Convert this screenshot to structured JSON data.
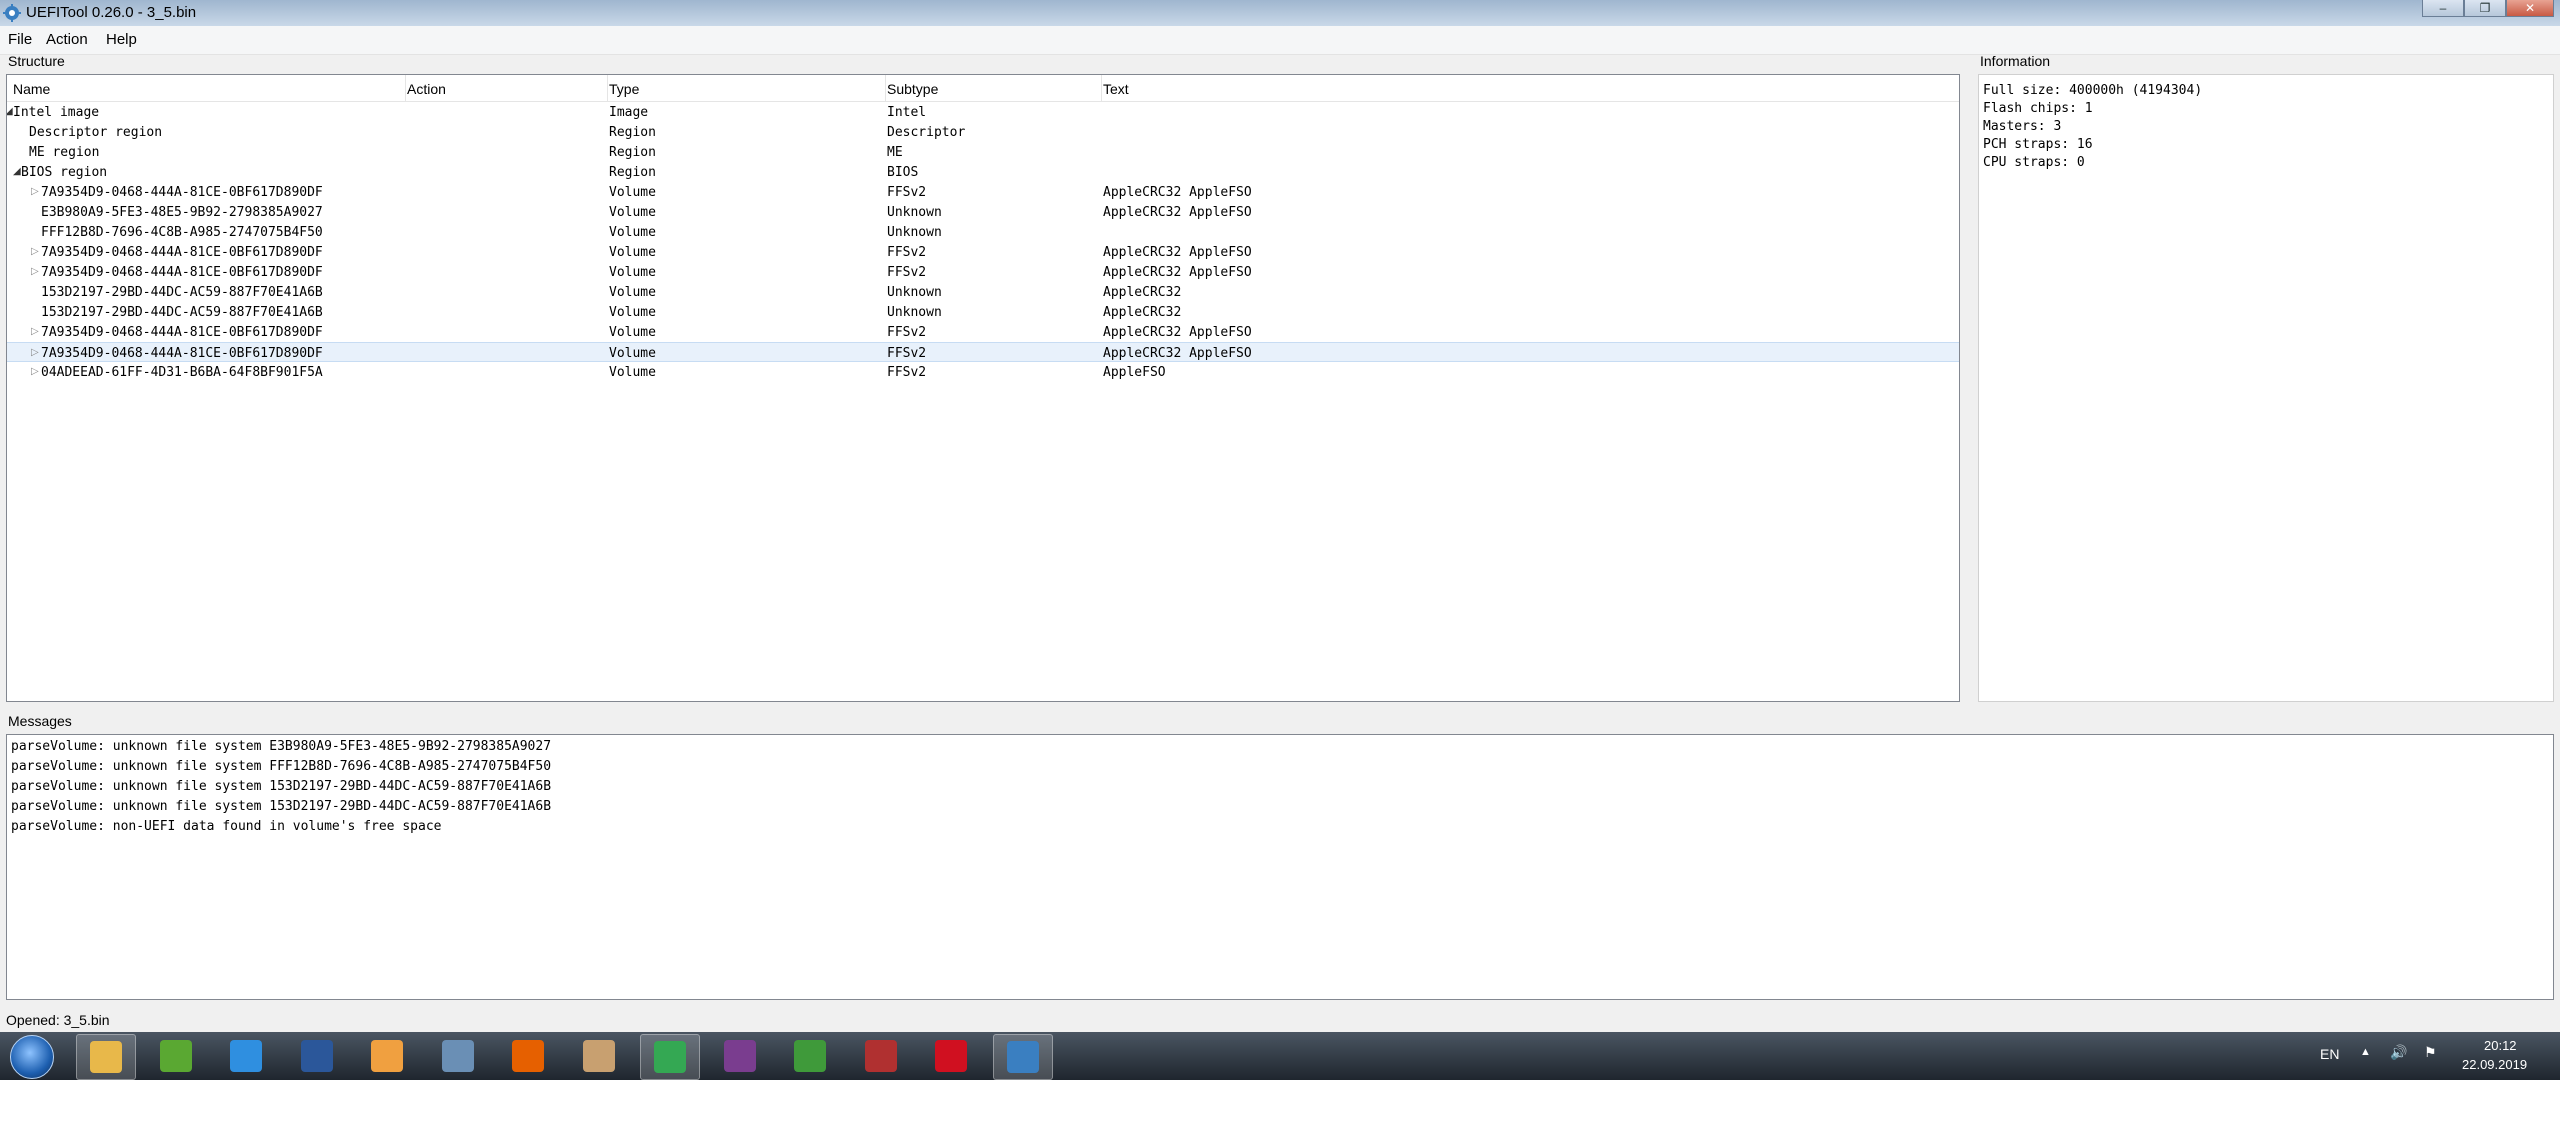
{
  "window": {
    "title": "UEFITool 0.26.0 - 3_5.bin",
    "controls": [
      "–",
      "❐",
      "✕"
    ]
  },
  "menu": [
    "File",
    "Action",
    "Help"
  ],
  "structure": {
    "label": "Structure",
    "columns": [
      "Name",
      "Action",
      "Type",
      "Subtype",
      "Text"
    ],
    "rows": [
      {
        "name": "Intel image",
        "type": "Image",
        "subtype": "Intel",
        "text": "",
        "arrow": "◢"
      },
      {
        "name": "Descriptor region",
        "type": "Region",
        "subtype": "Descriptor",
        "text": "",
        "arrow": ""
      },
      {
        "name": "ME region",
        "type": "Region",
        "subtype": "ME",
        "text": "",
        "arrow": ""
      },
      {
        "name": "BIOS region",
        "type": "Region",
        "subtype": "BIOS",
        "text": "",
        "arrow": "◢"
      },
      {
        "name": "7A9354D9-0468-444A-81CE-0BF617D890DF",
        "type": "Volume",
        "subtype": "FFSv2",
        "text": "AppleCRC32 AppleFSO",
        "arrow": "▷"
      },
      {
        "name": "E3B980A9-5FE3-48E5-9B92-2798385A9027",
        "type": "Volume",
        "subtype": "Unknown",
        "text": "AppleCRC32 AppleFSO",
        "arrow": ""
      },
      {
        "name": "FFF12B8D-7696-4C8B-A985-2747075B4F50",
        "type": "Volume",
        "subtype": "Unknown",
        "text": "",
        "arrow": ""
      },
      {
        "name": "7A9354D9-0468-444A-81CE-0BF617D890DF",
        "type": "Volume",
        "subtype": "FFSv2",
        "text": "AppleCRC32 AppleFSO",
        "arrow": "▷"
      },
      {
        "name": "7A9354D9-0468-444A-81CE-0BF617D890DF",
        "type": "Volume",
        "subtype": "FFSv2",
        "text": "AppleCRC32 AppleFSO",
        "arrow": "▷"
      },
      {
        "name": "153D2197-29BD-44DC-AC59-887F70E41A6B",
        "type": "Volume",
        "subtype": "Unknown",
        "text": "AppleCRC32",
        "arrow": ""
      },
      {
        "name": "153D2197-29BD-44DC-AC59-887F70E41A6B",
        "type": "Volume",
        "subtype": "Unknown",
        "text": "AppleCRC32",
        "arrow": ""
      },
      {
        "name": "7A9354D9-0468-444A-81CE-0BF617D890DF",
        "type": "Volume",
        "subtype": "FFSv2",
        "text": "AppleCRC32 AppleFSO",
        "arrow": "▷"
      },
      {
        "name": "7A9354D9-0468-444A-81CE-0BF617D890DF",
        "type": "Volume",
        "subtype": "FFSv2",
        "text": "AppleCRC32 AppleFSO",
        "arrow": "▷",
        "selected": true
      },
      {
        "name": "04ADEEAD-61FF-4D31-B6BA-64F8BF901F5A",
        "type": "Volume",
        "subtype": "FFSv2",
        "text": "AppleFSO",
        "arrow": "▷"
      }
    ]
  },
  "information": {
    "label": "Information",
    "lines": [
      "Full size: 400000h (4194304)",
      "Flash chips: 1",
      "Masters: 3",
      "PCH straps: 16",
      "CPU straps: 0"
    ]
  },
  "messages": {
    "label": "Messages",
    "lines": [
      "parseVolume: unknown file system E3B980A9-5FE3-48E5-9B92-2798385A9027",
      "parseVolume: unknown file system FFF12B8D-7696-4C8B-A985-2747075B4F50",
      "parseVolume: unknown file system 153D2197-29BD-44DC-AC59-887F70E41A6B",
      "parseVolume: unknown file system 153D2197-29BD-44DC-AC59-887F70E41A6B",
      "parseVolume: non-UEFI data found in volume's free space"
    ]
  },
  "status": "Opened: 3_5.bin",
  "taskbar": {
    "apps": [
      {
        "name": "explorer",
        "color": "#e8b84a",
        "active": true
      },
      {
        "name": "utorrent",
        "color": "#5aa832"
      },
      {
        "name": "media-player",
        "color": "#2f8fe0"
      },
      {
        "name": "word",
        "color": "#2b579a"
      },
      {
        "name": "video-player",
        "color": "#f0a040"
      },
      {
        "name": "calculator",
        "color": "#6a8fb5"
      },
      {
        "name": "firefox",
        "color": "#e66000"
      },
      {
        "name": "image-viewer",
        "color": "#c8a070"
      },
      {
        "name": "chrome",
        "color": "#34a853",
        "active": true
      },
      {
        "name": "pdf-tool",
        "color": "#7a3d8f"
      },
      {
        "name": "image-editor",
        "color": "#3f9a3a"
      },
      {
        "name": "calendar",
        "color": "#b03030"
      },
      {
        "name": "opera",
        "color": "#d01020"
      },
      {
        "name": "uefitool",
        "color": "#3a7fc1",
        "active": true
      }
    ],
    "language": "EN",
    "time": "20:12",
    "date": "22.09.2019"
  }
}
